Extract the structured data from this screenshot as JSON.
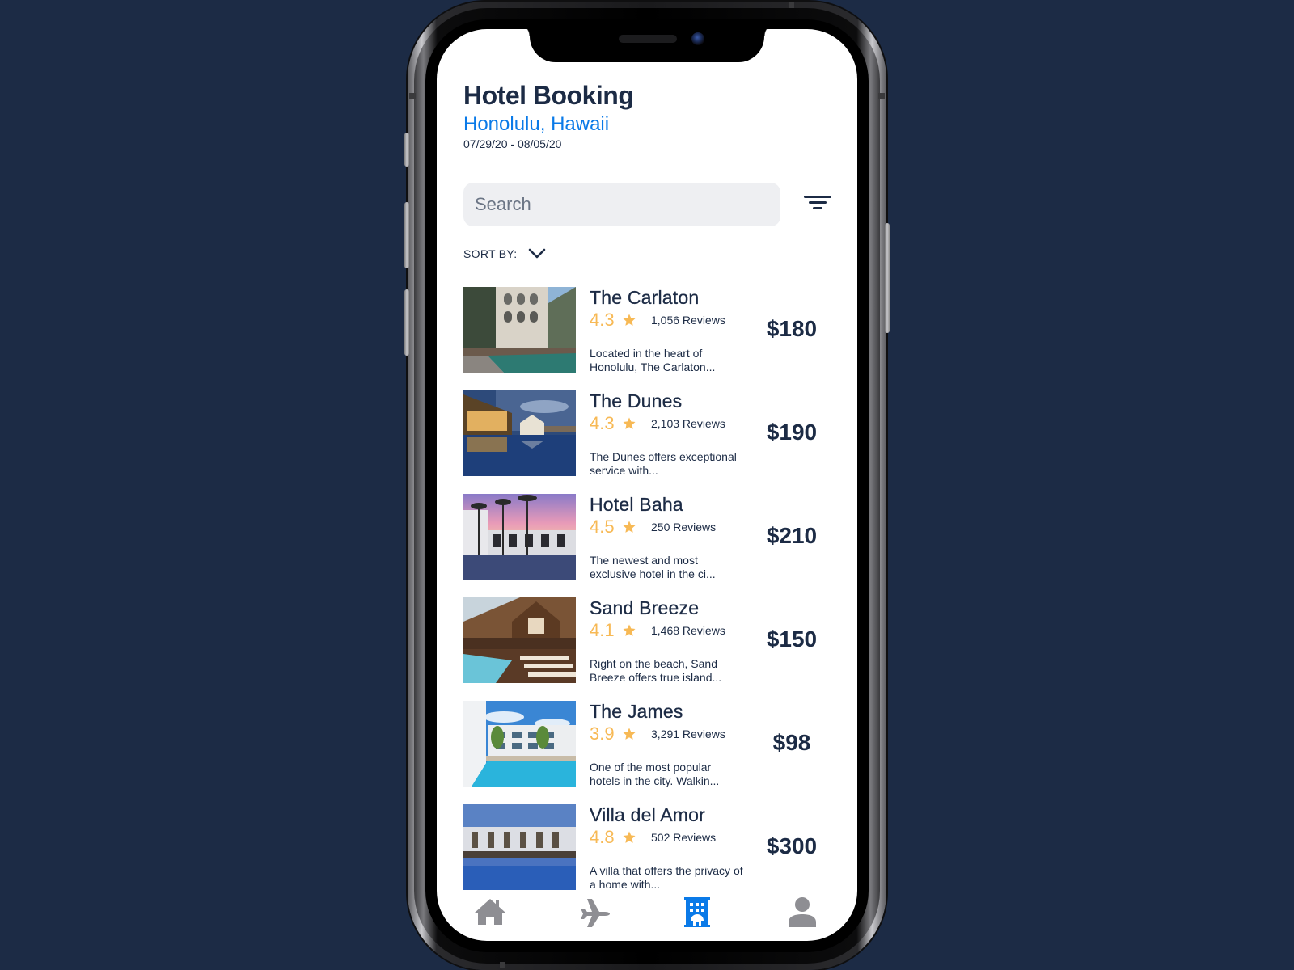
{
  "header": {
    "title": "Hotel Booking",
    "location": "Honolulu, Hawaii",
    "dates": "07/29/20 - 08/05/20"
  },
  "search": {
    "placeholder": "Search",
    "value": ""
  },
  "filter": {
    "icon": "filter-icon"
  },
  "sort": {
    "label": "SORT BY:",
    "icon": "chevron-down-icon"
  },
  "hotels": [
    {
      "name": "The Carlaton",
      "rating": "4.3",
      "reviews": "1,056 Reviews",
      "description": "Located in the heart of Honolulu, The Carlaton...",
      "price": "$180"
    },
    {
      "name": "The Dunes",
      "rating": "4.3",
      "reviews": "2,103 Reviews",
      "description": "The Dunes offers exceptional service with...",
      "price": "$190"
    },
    {
      "name": "Hotel Baha",
      "rating": "4.5",
      "reviews": "250 Reviews",
      "description": "The newest and most exclusive hotel in the ci...",
      "price": "$210"
    },
    {
      "name": "Sand Breeze",
      "rating": "4.1",
      "reviews": "1,468 Reviews",
      "description": "Right on the beach, Sand Breeze offers true island...",
      "price": "$150"
    },
    {
      "name": "The James",
      "rating": "3.9",
      "reviews": "3,291 Reviews",
      "description": "One of the most popular hotels in the city. Walkin...",
      "price": "$98"
    },
    {
      "name": "Villa del Amor",
      "rating": "4.8",
      "reviews": "502 Reviews",
      "description": "A villa that offers the privacy of a home with...",
      "price": "$300"
    }
  ],
  "tabbar": {
    "tabs": [
      {
        "name": "home",
        "icon": "home-icon",
        "active": false
      },
      {
        "name": "flights",
        "icon": "airplane-icon",
        "active": false
      },
      {
        "name": "hotels",
        "icon": "hotel-building-icon",
        "active": true
      },
      {
        "name": "profile",
        "icon": "user-icon",
        "active": false
      }
    ]
  },
  "colors": {
    "background": "#1c2b45",
    "text_primary": "#1c2b45",
    "accent_blue": "#0a7ae8",
    "rating_gold": "#f7b955",
    "tab_inactive": "#8e8e93",
    "search_bg": "#eeeff2"
  }
}
